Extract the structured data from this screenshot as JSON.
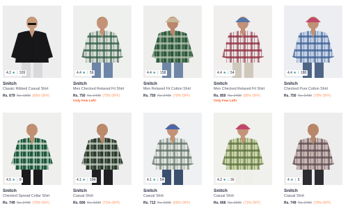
{
  "colors": {
    "accent": "#ff905a",
    "rating_star": "#14958f",
    "few_left": "#ff5722"
  },
  "products": [
    {
      "rating": "4.2",
      "count": "326",
      "brand": "Snitch",
      "name": "Classic Ribbed Casual Shirt",
      "price": "Rs. 679",
      "mrp": "Rs. 1999",
      "off": "(66% OFF)",
      "few": "",
      "art": {
        "shirt": "#17171a",
        "check": "",
        "pants": "#d9d9dc",
        "skin": "#c79a7c",
        "hair": "#202020",
        "cap": "",
        "accessory": "sunglasses-icon",
        "bg": "#ededee"
      }
    },
    {
      "rating": "4.4",
      "count": "56",
      "brand": "Snitch",
      "name": "Men Checked Relaxed Fit Shirt",
      "price": "Rs. 750",
      "mrp": "Rs. 2499",
      "off": "(70% OFF)",
      "few": "Only Few Left!",
      "art": {
        "shirt": "#d8ddd7",
        "check": "#2e5a43",
        "pants": "#6d86a8",
        "skin": "#c49276",
        "hair": "#222222",
        "cap": "",
        "accessory": "",
        "bg": "#eef0ee"
      }
    },
    {
      "rating": "4.4",
      "count": "158",
      "brand": "Snitch",
      "name": "Men Relaxed Fit Cotton Shirt",
      "price": "Rs. 750",
      "mrp": "Rs. 2499",
      "off": "(70% OFF)",
      "few": "",
      "art": {
        "shirt": "#2e5a3d",
        "check": "#b8c7b3",
        "pants": "#6f87a6",
        "skin": "#b9876b",
        "hair": "#2a2a2a",
        "cap": "#c9b79a",
        "accessory": "",
        "bg": "#eeeeec"
      }
    },
    {
      "rating": "4.4",
      "count": "54",
      "brand": "Snitch",
      "name": "Men Checked Relaxed Fit Shirt",
      "price": "Rs. 850",
      "mrp": "Rs. 2499",
      "off": "(66% OFF)",
      "few": "Only Few Left!",
      "art": {
        "shirt": "#e9e3e4",
        "check": "#8e2b3c",
        "pants": "#cfc8bc",
        "skin": "#c39176",
        "hair": "#2a2a2a",
        "cap": "#5877a8",
        "accessory": "",
        "bg": "#f1eeee"
      }
    },
    {
      "rating": "4.4",
      "count": "180",
      "brand": "Snitch",
      "name": "Checked Pure Cotton Shirt",
      "price": "Rs. 750",
      "mrp": "Rs. 2499",
      "off": "(70% OFF)",
      "few": "",
      "art": {
        "shirt": "#c6d3e6",
        "check": "#3c5f93",
        "pants": "#4e6587",
        "skin": "#c09176",
        "hair": "#222222",
        "cap": "#c44a6a",
        "accessory": "",
        "bg": "#eceef2"
      }
    },
    {
      "rating": "4.5",
      "count": "8",
      "brand": "Snitch",
      "name": "Checked Spread Collar Shirt",
      "price": "Rs. 749",
      "mrp": "Rs. 2499",
      "off": "(70% OFF)",
      "few": "",
      "art": {
        "shirt": "#1f5a3e",
        "check": "#d6e2d4",
        "pants": "#1b1b1d",
        "skin": "#c09072",
        "hair": "#1e1e1e",
        "cap": "",
        "accessory": "",
        "bg": "#efefee"
      }
    },
    {
      "rating": "4.1",
      "count": "104",
      "brand": "Snitch",
      "name": "Casual Shirt",
      "price": "Rs. 666",
      "mrp": "Rs. 2299",
      "off": "(71% OFF)",
      "few": "",
      "art": {
        "shirt": "#2a3b2d",
        "check": "#c9d1c4",
        "pants": "#202022",
        "skin": "#bb8a6d",
        "hair": "#202020",
        "cap": "",
        "accessory": "",
        "bg": "#eeeeee"
      }
    },
    {
      "rating": "4.1",
      "count": "54",
      "brand": "Snitch",
      "name": "Casual Shirt",
      "price": "Rs. 712",
      "mrp": "Rs. 2299",
      "off": "(69% OFF)",
      "few": "",
      "art": {
        "shirt": "#dfe3df",
        "check": "#5d6e64",
        "pants": "#3b4f6e",
        "skin": "#c39276",
        "hair": "#222222",
        "cap": "#4a68a8",
        "accessory": "",
        "bg": "#eff0f1"
      }
    },
    {
      "rating": "4.2",
      "count": "36",
      "brand": "Snitch",
      "name": "Casual Shirt",
      "price": "Rs. 666",
      "mrp": "Rs. 2299",
      "off": "(71% OFF)",
      "few": "",
      "art": {
        "shirt": "#c9d3a6",
        "check": "#5a6f3c",
        "pants": "#efefea",
        "skin": "#c59478",
        "hair": "#222222",
        "cap": "#c2456a",
        "accessory": "",
        "bg": "#f0f1ec"
      }
    },
    {
      "rating": "4",
      "count": "5",
      "brand": "Snitch",
      "name": "Casual Shirt",
      "price": "Rs. 749",
      "mrp": "Rs. 2499",
      "off": "(70% OFF)",
      "few": "",
      "art": {
        "shirt": "#c9b7b4",
        "check": "#5a4a4e",
        "pants": "#2d2d31",
        "skin": "#b88668",
        "hair": "#1b1b1b",
        "cap": "",
        "accessory": "",
        "bg": "#eeeded"
      }
    }
  ]
}
